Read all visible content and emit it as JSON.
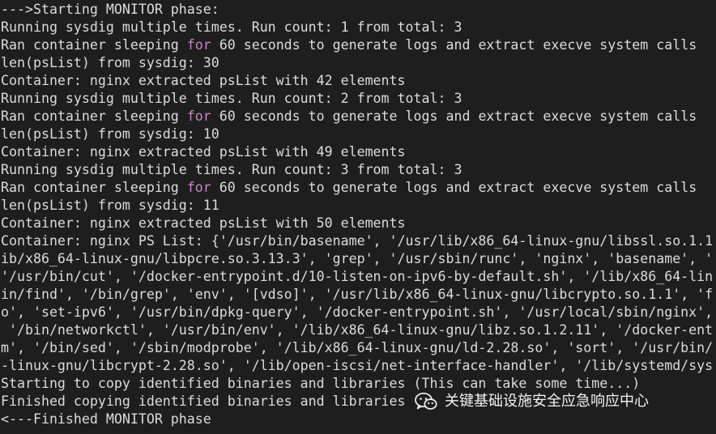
{
  "terminal": {
    "lines": [
      {
        "text": "--->Starting MONITOR phase:"
      },
      {
        "text": "Running sysdig multiple times. Run count: 1 from total: 3"
      },
      {
        "before": "Ran container sleeping ",
        "keyword": "for",
        "after": " 60 seconds to generate logs and extract execve system calls"
      },
      {
        "text": "len(psList) from sysdig: 30"
      },
      {
        "text": "Container: nginx extracted psList with 42 elements"
      },
      {
        "text": "Running sysdig multiple times. Run count: 2 from total: 3"
      },
      {
        "before": "Ran container sleeping ",
        "keyword": "for",
        "after": " 60 seconds to generate logs and extract execve system calls"
      },
      {
        "text": "len(psList) from sysdig: 10"
      },
      {
        "text": "Container: nginx extracted psList with 49 elements"
      },
      {
        "text": "Running sysdig multiple times. Run count: 3 from total: 3"
      },
      {
        "before": "Ran container sleeping ",
        "keyword": "for",
        "after": " 60 seconds to generate logs and extract execve system calls"
      },
      {
        "text": "len(psList) from sysdig: 11"
      },
      {
        "text": "Container: nginx extracted psList with 50 elements"
      },
      {
        "text": "Container: nginx PS List: {'/usr/bin/basename', '/usr/lib/x86_64-linux-gnu/libssl.so.1.1"
      },
      {
        "text": "ib/x86_64-linux-gnu/libpcre.so.3.13.3', 'grep', '/usr/sbin/runc', 'nginx', 'basename', '"
      },
      {
        "text": "'/usr/bin/cut', '/docker-entrypoint.d/10-listen-on-ipv6-by-default.sh', '/lib/x86_64-lin"
      },
      {
        "text": "in/find', '/bin/grep', 'env', '[vdso]', '/usr/lib/x86_64-linux-gnu/libcrypto.so.1.1', 'f"
      },
      {
        "text": "o', 'set-ipv6', '/usr/bin/dpkg-query', '/docker-entrypoint.sh', '/usr/local/sbin/nginx',"
      },
      {
        "text": " '/bin/networkctl', '/usr/bin/env', '/lib/x86_64-linux-gnu/libz.so.1.2.11', '/docker-ent"
      },
      {
        "text": "m', '/bin/sed', '/sbin/modprobe', '/lib/x86_64-linux-gnu/ld-2.28.so', 'sort', '/usr/bin/"
      },
      {
        "text": "-linux-gnu/libcrypt-2.28.so', '/lib/open-iscsi/net-interface-handler', '/lib/systemd/sys"
      },
      {
        "text": "Starting to copy identified binaries and libraries (This can take some time...)"
      },
      {
        "text": "Finished copying identified binaries and libraries"
      },
      {
        "text": "<---Finished MONITOR phase"
      }
    ]
  },
  "watermark": {
    "icon": "wechat-icon",
    "text": "关键基础设施安全应急响应中心"
  },
  "colors": {
    "background": "#1e1e1e",
    "foreground": "#dcdcdc",
    "keyword": "#c586c0"
  }
}
